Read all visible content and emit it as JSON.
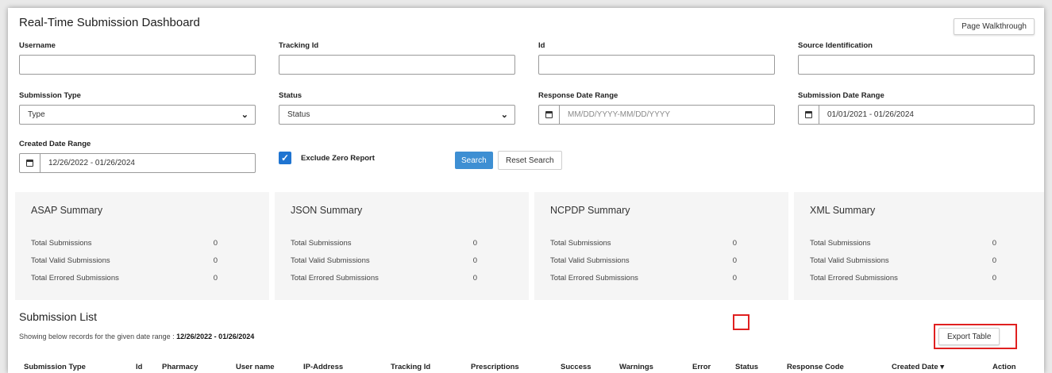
{
  "page": {
    "title": "Real-Time Submission Dashboard",
    "walkthrough_label": "Page Walkthrough"
  },
  "filters": {
    "username_label": "Username",
    "username_value": "",
    "tracking_id_label": "Tracking Id",
    "tracking_id_value": "",
    "id_label": "Id",
    "id_value": "",
    "source_identification_label": "Source Identification",
    "source_identification_value": "",
    "submission_type_label": "Submission Type",
    "submission_type_value": "Type",
    "status_label": "Status",
    "status_value": "Status",
    "response_date_label": "Response Date Range",
    "response_date_placeholder": "MM/DD/YYYY-MM/DD/YYYY",
    "submission_date_label": "Submission Date Range",
    "submission_date_value": "01/01/2021 - 01/26/2024",
    "created_date_label": "Created Date Range",
    "created_date_value": "12/26/2022 - 01/26/2024",
    "exclude_zero_label": "Exclude Zero Report",
    "exclude_zero_checked": true,
    "search_label": "Search",
    "reset_label": "Reset Search"
  },
  "summaries": [
    {
      "title": "ASAP Summary",
      "rows": [
        {
          "label": "Total Submissions",
          "value": "0"
        },
        {
          "label": "Total Valid Submissions",
          "value": "0"
        },
        {
          "label": "Total Errored Submissions",
          "value": "0"
        }
      ]
    },
    {
      "title": "JSON Summary",
      "rows": [
        {
          "label": "Total Submissions",
          "value": "0"
        },
        {
          "label": "Total Valid Submissions",
          "value": "0"
        },
        {
          "label": "Total Errored Submissions",
          "value": "0"
        }
      ]
    },
    {
      "title": "NCPDP Summary",
      "rows": [
        {
          "label": "Total Submissions",
          "value": "0"
        },
        {
          "label": "Total Valid Submissions",
          "value": "0"
        },
        {
          "label": "Total Errored Submissions",
          "value": "0"
        }
      ]
    },
    {
      "title": "XML Summary",
      "rows": [
        {
          "label": "Total Submissions",
          "value": "0"
        },
        {
          "label": "Total Valid Submissions",
          "value": "0"
        },
        {
          "label": "Total Errored Submissions",
          "value": "0"
        }
      ]
    }
  ],
  "submission_list": {
    "title": "Submission List",
    "range_prefix": "Showing below records for the given date range :",
    "range_value": "12/26/2022 - 01/26/2024",
    "export_label": "Export Table",
    "columns": [
      "Submission Type",
      "Id",
      "Pharmacy",
      "User name",
      "IP-Address",
      "Tracking Id",
      "Prescriptions",
      "Success",
      "Warnings",
      "Error",
      "Status",
      "Response Code",
      "Created Date ▾",
      "Action"
    ]
  },
  "icons": {
    "calendar": "calendar-icon",
    "chevron": "chevron-down-icon",
    "check": "checkmark-icon"
  },
  "colors": {
    "primary_button": "#3e8fd3",
    "checkbox": "#1f74d1",
    "highlight": "#e02020",
    "summary_bg": "#f5f5f5"
  }
}
